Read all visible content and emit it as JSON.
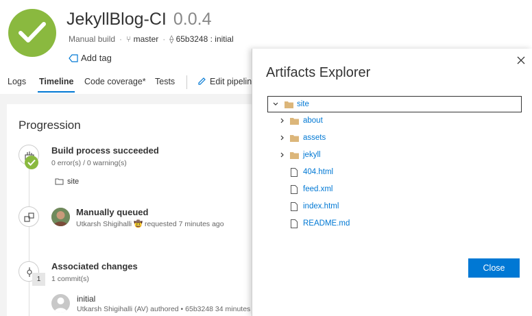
{
  "header": {
    "build_name": "JekyllBlog-CI",
    "version": "0.0.4",
    "trigger": "Manual build",
    "branch": "master",
    "commit": "65b3248 : initial",
    "add_tag": "Add tag"
  },
  "tabs": [
    {
      "label": "Logs"
    },
    {
      "label": "Timeline"
    },
    {
      "label": "Code coverage*"
    },
    {
      "label": "Tests"
    },
    {
      "label": "Edit pipelin"
    }
  ],
  "progression": {
    "title": "Progression",
    "steps": [
      {
        "title": "Build process succeeded",
        "subtitle": "0 error(s) / 0 warning(s)",
        "artifact": "site"
      },
      {
        "title": "Manually queued",
        "subtitle": "Utkarsh Shigihalli 🤠 requested 7 minutes ago"
      },
      {
        "title": "Associated changes",
        "subtitle": "1 commit(s)",
        "count": "1"
      }
    ],
    "commit": {
      "message": "initial",
      "meta": "Utkarsh Shigihalli (AV) authored  • 65b3248  34 minutes a"
    }
  },
  "artifacts_panel": {
    "title": "Artifacts Explorer",
    "tree": [
      {
        "label": "site",
        "type": "folder",
        "expanded": true,
        "depth": 0
      },
      {
        "label": "about",
        "type": "folder",
        "expanded": false,
        "depth": 1
      },
      {
        "label": "assets",
        "type": "folder",
        "expanded": false,
        "depth": 1
      },
      {
        "label": "jekyll",
        "type": "folder",
        "expanded": false,
        "depth": 1
      },
      {
        "label": "404.html",
        "type": "file",
        "depth": 1
      },
      {
        "label": "feed.xml",
        "type": "file",
        "depth": 1
      },
      {
        "label": "index.html",
        "type": "file",
        "depth": 1
      },
      {
        "label": "README.md",
        "type": "file",
        "depth": 1
      }
    ],
    "close_button": "Close"
  },
  "colors": {
    "success": "#8ab93f",
    "accent": "#0078d4",
    "folder": "#dcb67a"
  }
}
